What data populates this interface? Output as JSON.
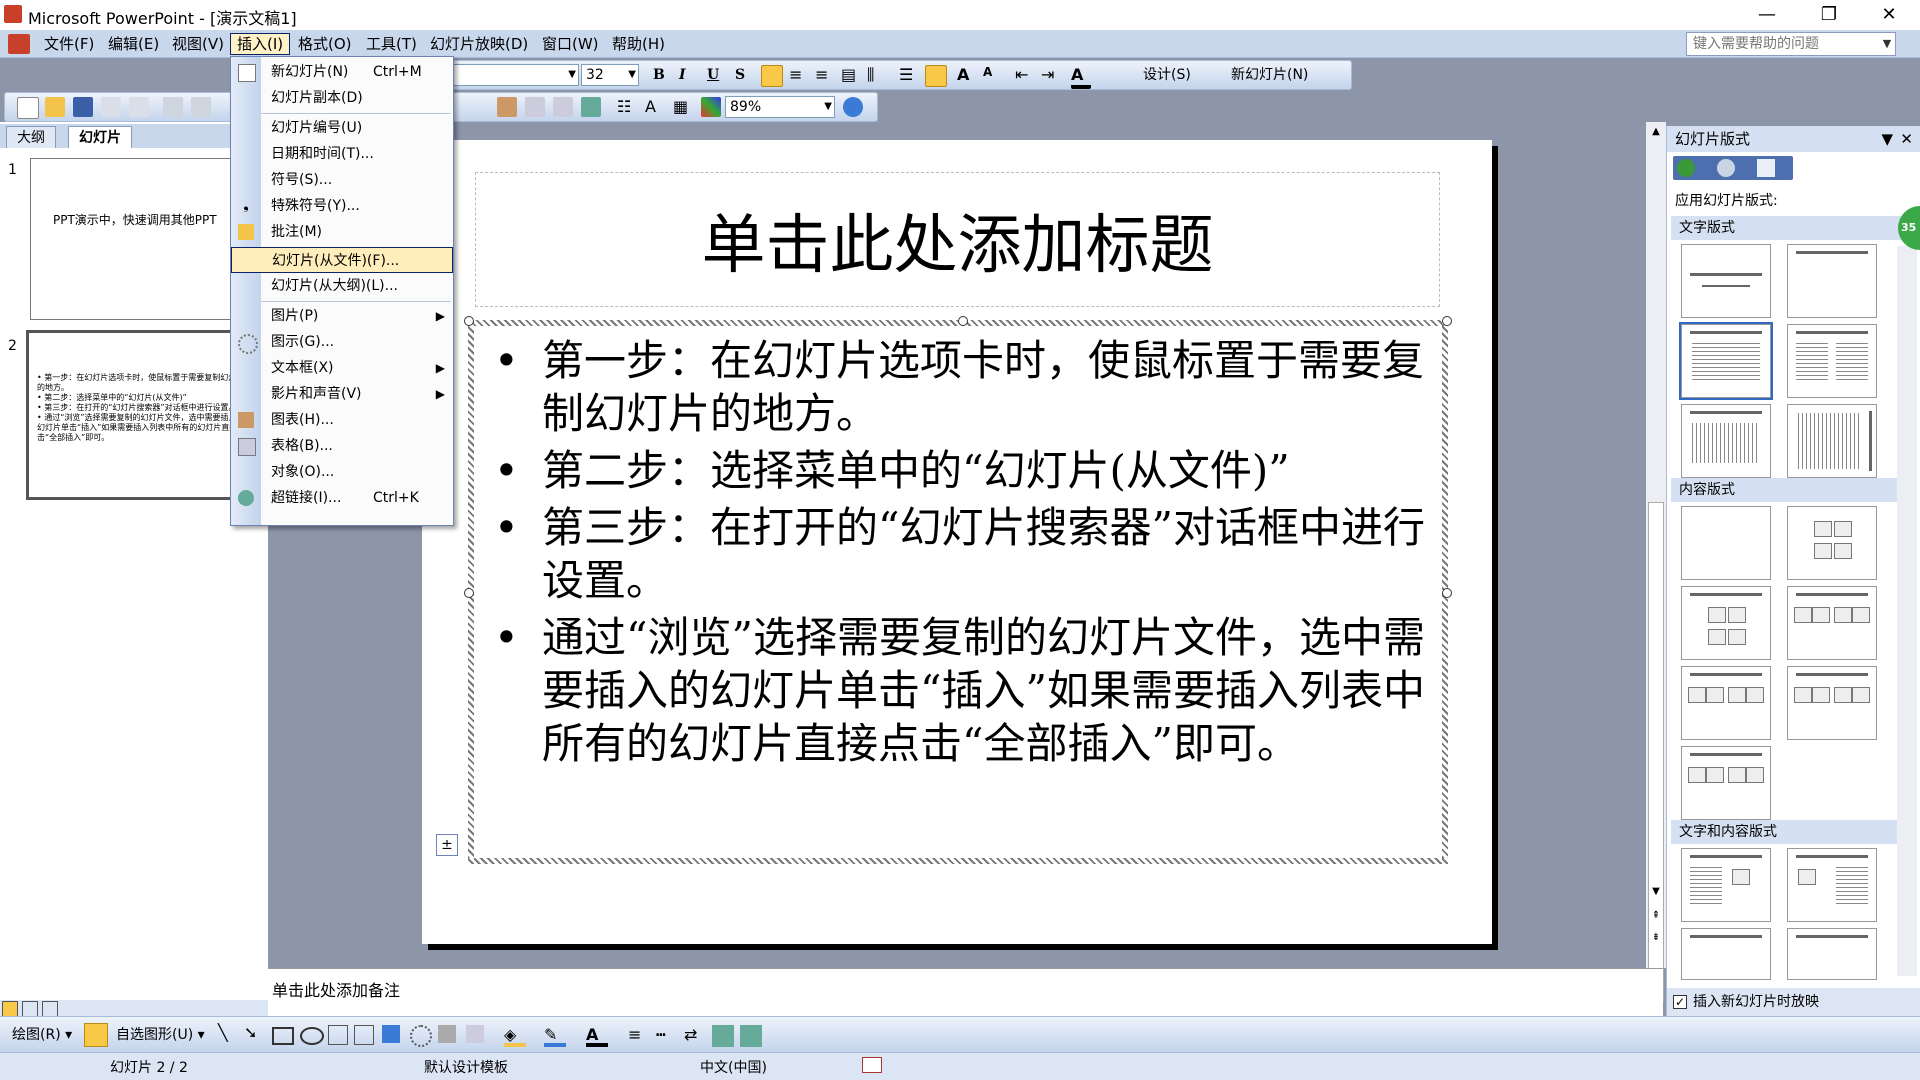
{
  "window": {
    "title": "Microsoft PowerPoint - [演示文稿1]",
    "minimize_glyph": "—",
    "restore_glyph": "❐",
    "close_glyph": "✕"
  },
  "menu": {
    "items": [
      "文件(F)",
      "编辑(E)",
      "视图(V)",
      "插入(I)",
      "格式(O)",
      "工具(T)",
      "幻灯片放映(D)",
      "窗口(W)",
      "帮助(H)"
    ],
    "help_placeholder": "键入需要帮助的问题"
  },
  "toolbar": {
    "font_size": "32",
    "zoom": "89%",
    "design_label": "设计(S)",
    "new_slide_label": "新幻灯片(N)",
    "bold": "B",
    "italic": "I",
    "underline": "U",
    "shadow": "S"
  },
  "insert_menu": {
    "items": [
      {
        "label": "新幻灯片(N)",
        "shortcut": "Ctrl+M"
      },
      {
        "label": "幻灯片副本(D)",
        "shortcut": ""
      },
      {
        "label": "幻灯片编号(U)",
        "shortcut": ""
      },
      {
        "label": "日期和时间(T)...",
        "shortcut": ""
      },
      {
        "label": "符号(S)...",
        "shortcut": ""
      },
      {
        "label": "特殊符号(Y)...",
        "shortcut": ""
      },
      {
        "label": "批注(M)",
        "shortcut": ""
      },
      {
        "label": "幻灯片(从文件)(F)...",
        "shortcut": ""
      },
      {
        "label": "幻灯片(从大纲)(L)...",
        "shortcut": ""
      },
      {
        "label": "图片(P)",
        "shortcut": ""
      },
      {
        "label": "图示(G)...",
        "shortcut": ""
      },
      {
        "label": "文本框(X)",
        "shortcut": ""
      },
      {
        "label": "影片和声音(V)",
        "shortcut": ""
      },
      {
        "label": "图表(H)...",
        "shortcut": ""
      },
      {
        "label": "表格(B)...",
        "shortcut": ""
      },
      {
        "label": "对象(O)...",
        "shortcut": ""
      },
      {
        "label": "超链接(I)...",
        "shortcut": "Ctrl+K"
      }
    ]
  },
  "left_pane": {
    "tabs": [
      "大纲",
      "幻灯片"
    ],
    "slide1_num": "1",
    "slide1_text": "PPT演示中，快速调用其他PPT",
    "slide2_num": "2",
    "slide2_lines": [
      "• 第一步：在幻灯片选项卡时，使鼠标置于需要复制幻灯片的地方。",
      "• 第二步：选择菜单中的“幻灯片(从文件)”",
      "• 第三步：在打开的“幻灯片搜索器”对话框中进行设置。",
      "• 通过“浏览”选择需要复制的幻灯片文件，选中需要插入的幻灯片单击“插入”如果需要插入列表中所有的幻灯片直接点击“全部插入”即可。"
    ]
  },
  "slide": {
    "title": "单击此处添加标题",
    "bullets": [
      "第一步：在幻灯片选项卡时，使鼠标置于需要复制幻灯片的地方。",
      "第二步：选择菜单中的“幻灯片(从文件)”",
      "第三步：在打开的“幻灯片搜索器”对话框中进行设置。",
      "通过“浏览”选择需要复制的幻灯片文件，选中需要插入的幻灯片单击“插入”如果需要插入列表中所有的幻灯片直接点击“全部插入”即可。"
    ]
  },
  "notes": {
    "placeholder": "单击此处添加备注"
  },
  "task_pane": {
    "title": "幻灯片版式",
    "apply_label": "应用幻灯片版式:",
    "section_text": "文字版式",
    "section_content": "内容版式",
    "section_text_content": "文字和内容版式",
    "show_on_insert": "插入新幻灯片时放映",
    "badge": "35"
  },
  "drawing_toolbar": {
    "draw_label": "绘图(R)",
    "autoshapes_label": "自选图形(U)"
  },
  "status": {
    "slide_info": "幻灯片 2 / 2",
    "template": "默认设计模板",
    "language": "中文(中国)"
  }
}
